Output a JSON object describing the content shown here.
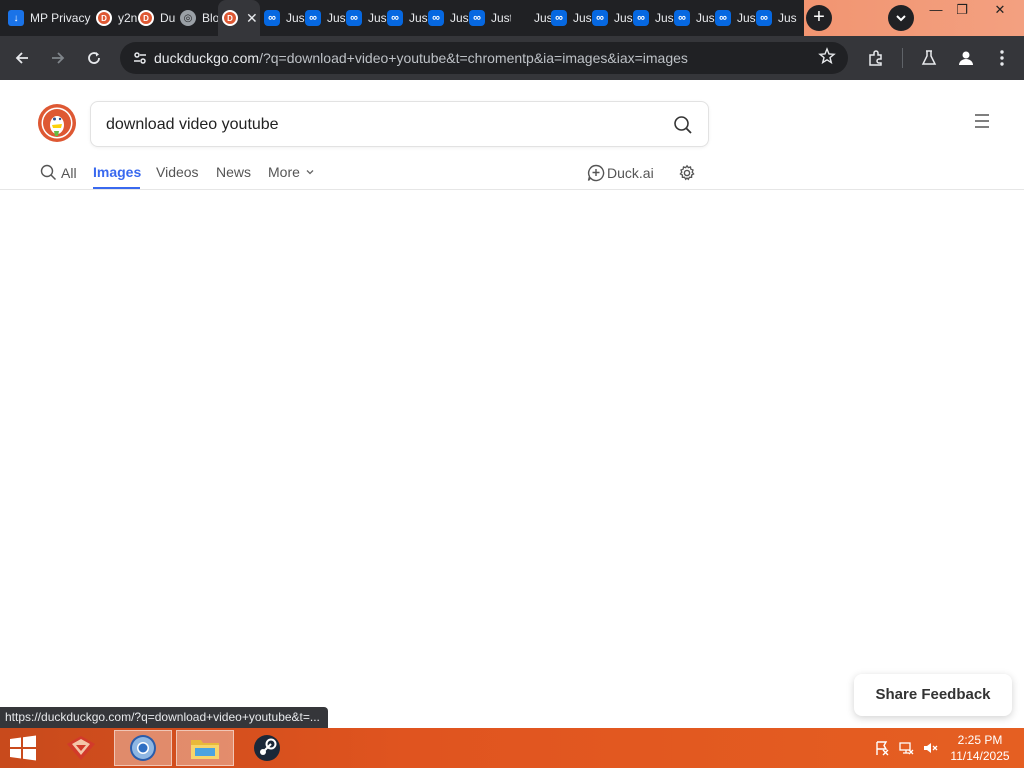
{
  "browser": {
    "tabs": [
      {
        "label": "MP Privacy",
        "favicon": "download-icon"
      },
      {
        "label": "y2n",
        "favicon": "duckduckgo-icon"
      },
      {
        "label": "Du",
        "favicon": "duckduckgo-icon"
      },
      {
        "label": "Blo",
        "favicon": "globe-icon"
      },
      {
        "label": "",
        "favicon": "duckduckgo-icon",
        "active": true
      },
      {
        "label": "Jus",
        "favicon": "infinity-icon"
      },
      {
        "label": "Jus",
        "favicon": "infinity-icon"
      },
      {
        "label": "Jus",
        "favicon": "infinity-icon"
      },
      {
        "label": "Jus",
        "favicon": "infinity-icon"
      },
      {
        "label": "Jus",
        "favicon": "infinity-icon"
      },
      {
        "label": "Just",
        "favicon": "infinity-icon"
      },
      {
        "label": "Jus",
        "favicon": "infinity-icon"
      },
      {
        "label": "Jus",
        "favicon": "infinity-icon"
      },
      {
        "label": "Jus",
        "favicon": "infinity-icon"
      },
      {
        "label": "Jus",
        "favicon": "infinity-icon"
      },
      {
        "label": "Jus",
        "favicon": "infinity-icon"
      },
      {
        "label": "Jus",
        "favicon": "infinity-icon"
      }
    ],
    "new_tab_symbol": "+",
    "window_controls": {
      "minimize": "—",
      "restore": "❐",
      "close": "✕"
    },
    "address": {
      "host": "duckduckgo.com",
      "path": "/?q=download+video+youtube&t=chromentp&ia=images&iax=images"
    },
    "status_url": "https://duckduckgo.com/?q=download+video+youtube&t=..."
  },
  "page": {
    "search": {
      "value": "download video youtube"
    },
    "nav": {
      "all": "All",
      "images": "Images",
      "videos": "Videos",
      "news": "News",
      "more": "More",
      "duckai": "Duck.ai"
    },
    "feedback": "Share Feedback"
  },
  "taskbar": {
    "apps": [
      "pdf-app-icon",
      "chrome-icon",
      "file-explorer-icon",
      "steam-icon"
    ],
    "clock": {
      "time": "2:25 PM",
      "date": "11/14/2025"
    }
  },
  "colors": {
    "ddg_accent": "#3969ef",
    "ddg_orange": "#de5833",
    "chrome_dark": "#202124",
    "taskbar": "#e0541f"
  }
}
